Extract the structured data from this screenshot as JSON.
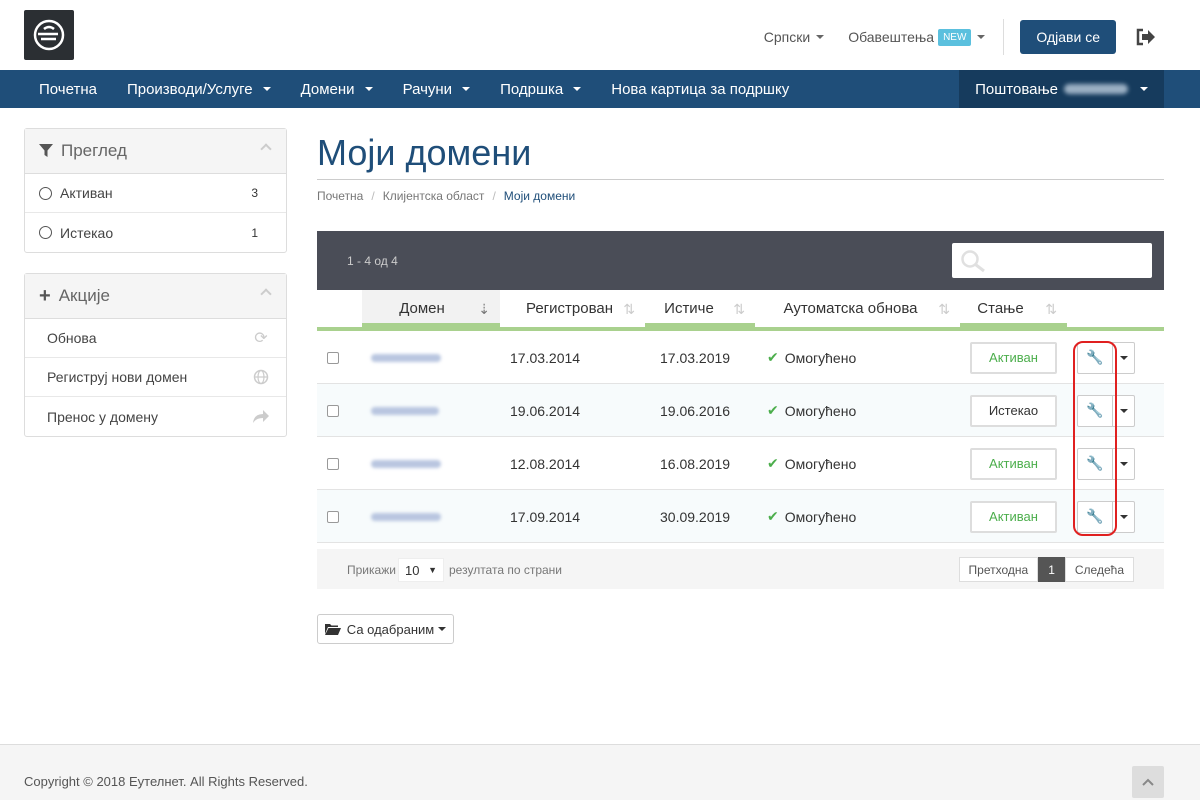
{
  "header": {
    "language": "Српски",
    "notifications": "Обавештења",
    "new_badge": "NEW",
    "logout": "Одјави се"
  },
  "nav": {
    "items": [
      "Почетна",
      "Производи/Услуге",
      "Домени",
      "Рачуни",
      "Подршка",
      "Нова картица за подршку"
    ],
    "greeting": "Поштовање"
  },
  "sidebar": {
    "overview_title": "Преглед",
    "filters": [
      {
        "label": "Активан",
        "count": "3"
      },
      {
        "label": "Истекао",
        "count": "1"
      }
    ],
    "actions_title": "Акције",
    "actions": [
      "Обнова",
      "Региструј нови домен",
      "Пренос у домену"
    ]
  },
  "page": {
    "title": "Моји домени",
    "breadcrumb": [
      "Почетна",
      "Клијентска област",
      "Моји домени"
    ]
  },
  "table": {
    "info": "1 - 4 од 4",
    "columns": [
      "Домен",
      "Регистрован",
      "Истиче",
      "Аутоматска обнова",
      "Стање"
    ],
    "rows": [
      {
        "registered": "17.03.2014",
        "expires": "17.03.2019",
        "autorenew": "Омогућено",
        "status": "Активан",
        "status_color": "#4cae4c"
      },
      {
        "registered": "19.06.2014",
        "expires": "19.06.2016",
        "autorenew": "Омогућено",
        "status": "Истекао",
        "status_color": "#333333"
      },
      {
        "registered": "12.08.2014",
        "expires": "16.08.2019",
        "autorenew": "Омогућено",
        "status": "Активан",
        "status_color": "#4cae4c"
      },
      {
        "registered": "17.09.2014",
        "expires": "30.09.2019",
        "autorenew": "Омогућено",
        "status": "Активан",
        "status_color": "#4cae4c"
      }
    ],
    "show_label": "Прикажи",
    "per_page": "10",
    "results_label": "резултата по страни",
    "prev": "Претходна",
    "page": "1",
    "next": "Следећа"
  },
  "bulk_action": "Са одабраним",
  "footer": {
    "copyright": "Copyright © 2018 Еутелнет. All Rights Reserved."
  },
  "colors": {
    "primary": "#1f4e79",
    "accent_green": "#a9d18e",
    "highlight": "#e02020"
  }
}
